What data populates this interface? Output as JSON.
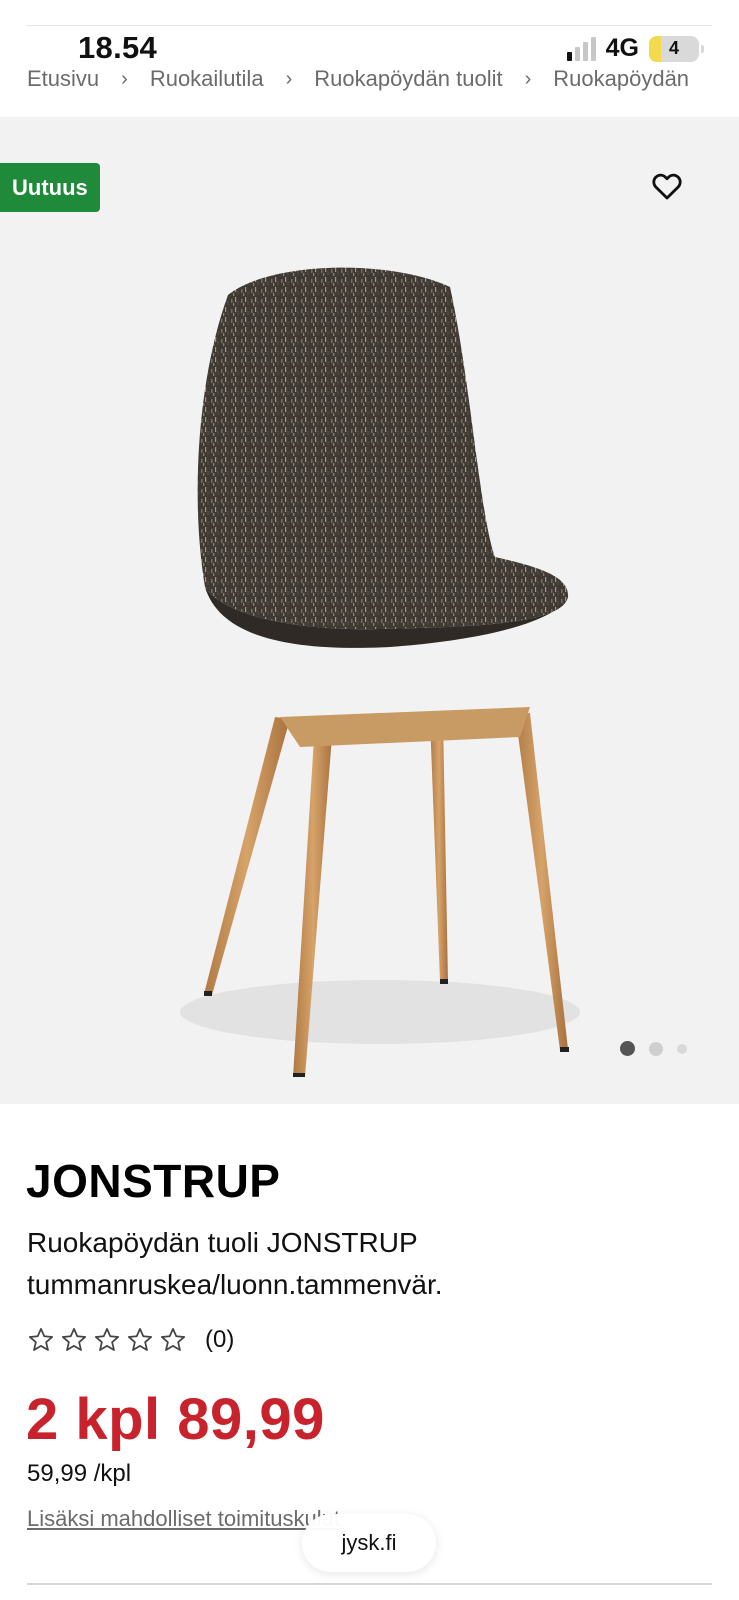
{
  "status_bar": {
    "time": "18.54",
    "network": "4G",
    "battery": "4",
    "signal_bars_on": 1,
    "signal_bars_total": 4
  },
  "breadcrumb": {
    "items": [
      "Etusivu",
      "Ruokailutila",
      "Ruokapöydän tuolit",
      "Ruokapöydän"
    ],
    "separator": "›"
  },
  "gallery": {
    "badge": "Uutuus",
    "favorite_icon": "heart-outline-icon",
    "image_count": 3,
    "active_index": 0
  },
  "product": {
    "name": "JONSTRUP",
    "description": "Ruokapöydän tuoli JONSTRUP tummanruskea/luonn.tammenvär.",
    "rating": {
      "stars": 0,
      "max": 5,
      "count_label": "(0)"
    },
    "price": "2 kpl 89,99",
    "unit_price": "59,99 /kpl",
    "delivery_note": "Lisäksi mahdolliset toimituskulut"
  },
  "browser": {
    "url": "jysk.fi"
  },
  "colors": {
    "badge": "#1f8a3a",
    "price": "#c8232c",
    "gallery_bg": "#f3f2f2"
  }
}
